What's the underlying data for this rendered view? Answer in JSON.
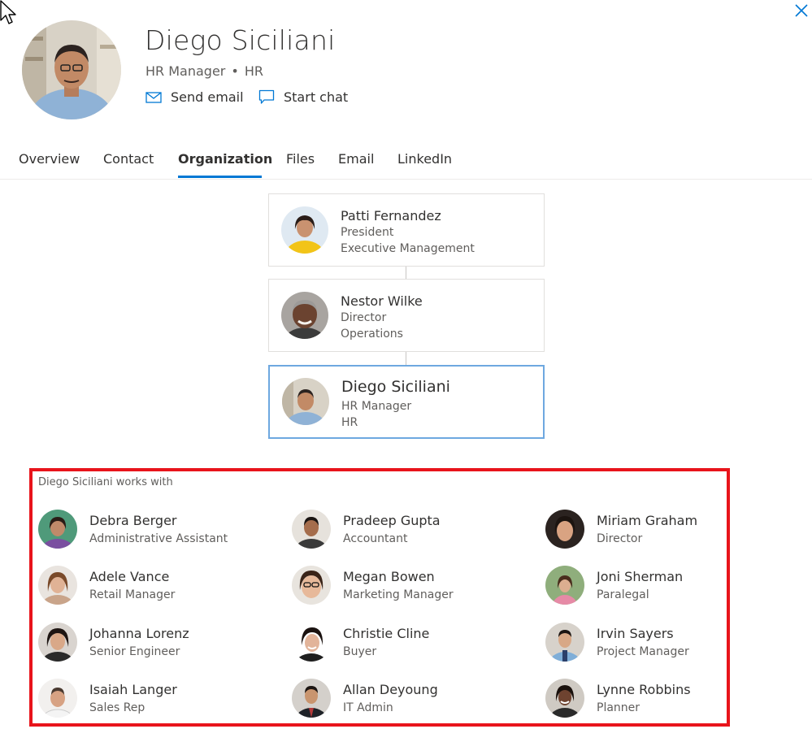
{
  "profile": {
    "name": "Diego Siciliani",
    "title": "HR Manager",
    "separator": "•",
    "department": "HR"
  },
  "actions": {
    "send_email": "Send email",
    "start_chat": "Start chat"
  },
  "tabs": [
    {
      "label": "Overview",
      "active": false
    },
    {
      "label": "Contact",
      "active": false
    },
    {
      "label": "Organization",
      "active": true
    },
    {
      "label": "Files",
      "active": false
    },
    {
      "label": "Email",
      "active": false
    },
    {
      "label": "LinkedIn",
      "active": false
    }
  ],
  "org_chain": [
    {
      "name": "Patti Fernandez",
      "title": "President",
      "department": "Executive Management"
    },
    {
      "name": "Nestor Wilke",
      "title": "Director",
      "department": "Operations"
    },
    {
      "name": "Diego Siciliani",
      "title": "HR Manager",
      "department": "HR"
    }
  ],
  "works_with": {
    "label": "Diego Siciliani works with",
    "people": [
      {
        "name": "Debra Berger",
        "title": "Administrative Assistant"
      },
      {
        "name": "Pradeep Gupta",
        "title": "Accountant"
      },
      {
        "name": "Miriam Graham",
        "title": "Director"
      },
      {
        "name": "Adele Vance",
        "title": "Retail Manager"
      },
      {
        "name": "Megan Bowen",
        "title": "Marketing Manager"
      },
      {
        "name": "Joni Sherman",
        "title": "Paralegal"
      },
      {
        "name": "Johanna Lorenz",
        "title": "Senior Engineer"
      },
      {
        "name": "Christie Cline",
        "title": "Buyer"
      },
      {
        "name": "Irvin Sayers",
        "title": "Project Manager"
      },
      {
        "name": "Isaiah Langer",
        "title": "Sales Rep"
      },
      {
        "name": "Allan Deyoung",
        "title": "IT Admin"
      },
      {
        "name": "Lynne Robbins",
        "title": "Planner"
      }
    ]
  },
  "icons": {
    "close": "close-icon",
    "email": "mail-icon",
    "chat": "chat-icon",
    "cursor": "mouse-cursor-icon"
  },
  "colors": {
    "accent": "#0078d4",
    "highlight_box": "#e8141b",
    "current_card_border": "#6ea8e0",
    "text": "#323130",
    "secondary_text": "#605e5c"
  }
}
